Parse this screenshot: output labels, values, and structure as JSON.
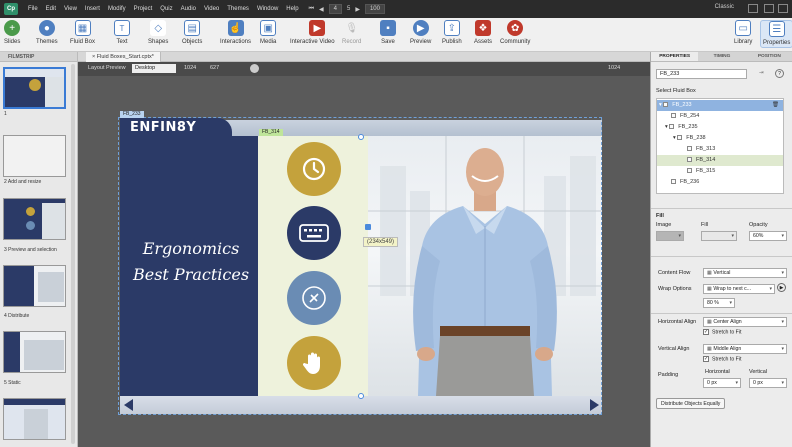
{
  "menubar": {
    "items": [
      "File",
      "Edit",
      "View",
      "Insert",
      "Modify",
      "Project",
      "Quiz",
      "Audio",
      "Video",
      "Themes",
      "Window",
      "Help"
    ],
    "slide_number": "4",
    "slide_total": "5",
    "zoom": "100",
    "theme": "Classic"
  },
  "toolbar": {
    "slides": "Slides",
    "themes": "Themes",
    "fluid_box": "Fluid Box",
    "text": "Text",
    "shapes": "Shapes",
    "objects": "Objects",
    "interactions": "Interactions",
    "media": "Media",
    "interactive_video": "Interactive Video",
    "record": "Record",
    "save": "Save",
    "preview": "Preview",
    "publish": "Publish",
    "assets": "Assets",
    "community": "Community",
    "library": "Library",
    "properties": "Properties"
  },
  "filmstrip": {
    "title": "FILMSTRIP",
    "slides": [
      {
        "label": "1"
      },
      {
        "label": "2 Add and resize"
      },
      {
        "label": "3 Preview and selection"
      },
      {
        "label": "4 Distribute"
      },
      {
        "label": "5 Static"
      }
    ]
  },
  "document": {
    "tab": "Fluid Boxes_Start.cptx*",
    "layout_label": "Layout Preview",
    "layout_value": "Desktop",
    "width": "1024",
    "height": "627",
    "ruler_right": "1024"
  },
  "slide": {
    "logo": "ENFIN8Y",
    "title": "Ergonomics Best Practices",
    "fb_outer_tag": "FB_233",
    "fb_inner_tag": "FB_314",
    "dimensions": "(234x549)"
  },
  "properties": {
    "tabs": [
      "PROPERTIES",
      "TIMING",
      "POSITION"
    ],
    "name": "FB_233",
    "select_label": "Select Fluid Box",
    "tree": [
      "FB_233",
      "FB_254",
      "FB_235",
      "FB_238",
      "FB_313",
      "FB_314",
      "FB_315",
      "FB_236"
    ],
    "fill_section": "Fill",
    "image_label": "Image",
    "fill_label": "Fill",
    "opacity_label": "Opacity",
    "opacity_value": "60%",
    "content_flow_label": "Content Flow",
    "content_flow_value": "Vertical",
    "wrap_label": "Wrap Options",
    "wrap_value": "Wrap to next c...",
    "wrap_percent": "80 %",
    "halign_label": "Horizontal Align",
    "halign_value": "Center Align",
    "stretch_label": "Stretch to Fit",
    "valign_label": "Vertical Align",
    "valign_value": "Middle Align",
    "padding_label": "Padding",
    "horizontal_label": "Horizontal",
    "vertical_label": "Vertical",
    "pad_h": "0 px",
    "pad_v": "0 px",
    "distribute": "Distribute Objects Equally"
  },
  "colors": {
    "navy": "#2b3a67",
    "gold": "#c4a23c",
    "steel": "#6a8cb4",
    "accent": "#3a7bd5"
  }
}
